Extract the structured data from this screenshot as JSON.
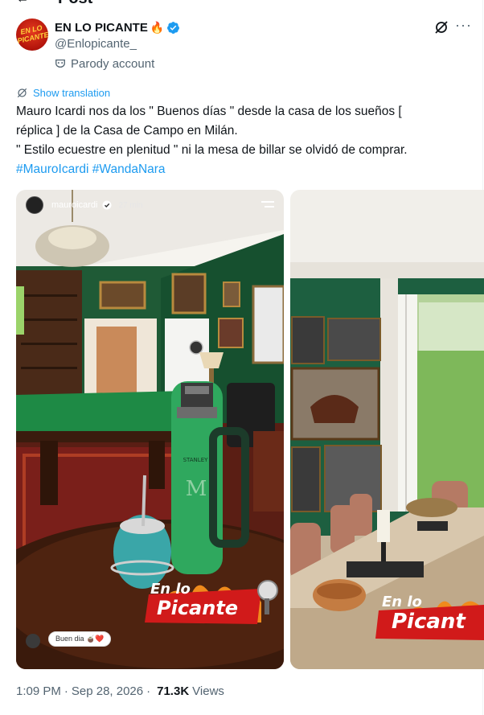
{
  "header": {
    "back_icon": "arrow-left-icon",
    "title": "Post"
  },
  "author": {
    "name": "EN LO PICANTE",
    "name_emoji": "🔥",
    "handle": "@Enlopicante_",
    "parody_label": "Parody account",
    "avatar_text": "EN LO PICANTE",
    "verified_color": "#1d9bf0"
  },
  "actions": {
    "grok_icon": "grok-icon",
    "more_icon": "more-icon"
  },
  "post": {
    "translate_label": "Show translation",
    "lines": [
      "Mauro Icardi nos da los \" Buenos días \" desde la casa de los sueños [",
      "réplica ] de la Casa de Campo en Milán.",
      "\" Estilo ecuestre en plenitud \" ni la mesa de billar se olvidó de comprar."
    ],
    "hashtags": [
      "#MauroIcardi",
      "#WandaNara"
    ]
  },
  "media": {
    "story_user": "mauroicardi",
    "story_time": "27 min",
    "reply_bubble": "Buen dia 🧉❤️",
    "flask_brand": "STANLEY",
    "logo_line1": "En lo",
    "logo_line2": "Picante",
    "logo2_line1": "En lo",
    "logo2_line2": "Picant"
  },
  "meta": {
    "time": "1:09 PM",
    "separator": "·",
    "date": "Sep 28, 2026",
    "views_count": "71.3K",
    "views_label": "Views"
  },
  "colors": {
    "accent": "#1d9bf0",
    "secondary_text": "#536471",
    "primary_text": "#0f1419"
  }
}
